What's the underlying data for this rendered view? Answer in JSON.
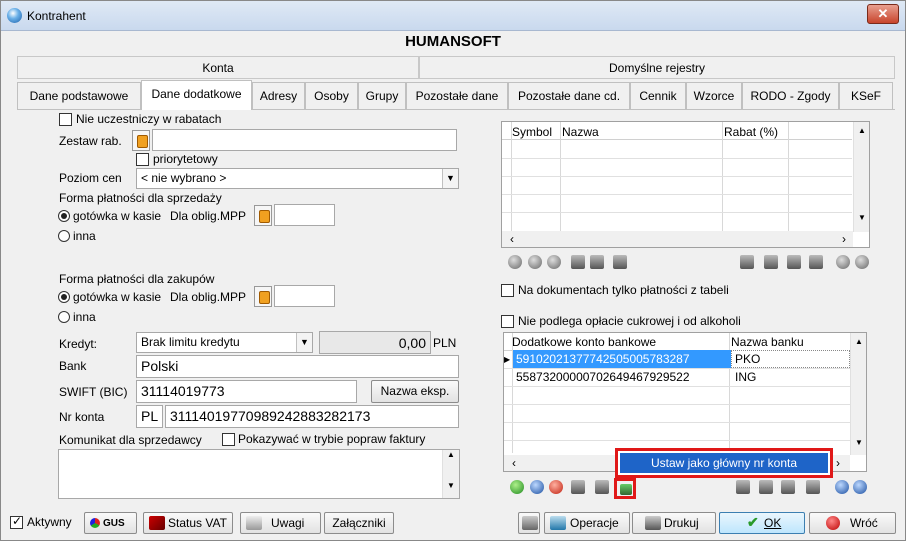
{
  "window": {
    "title": "Kontrahent",
    "close_glyph": "✕"
  },
  "header": {
    "title": "HUMANSOFT"
  },
  "group_tabs": [
    "Konta",
    "Domyślne rejestry"
  ],
  "tabs": [
    "Dane podstawowe",
    "Dane dodatkowe",
    "Adresy",
    "Osoby",
    "Grupy",
    "Pozostałe dane",
    "Pozostałe dane cd.",
    "Cennik",
    "Wzorce",
    "RODO - Zgody",
    "KSeF"
  ],
  "active_tab": "Dane dodatkowe",
  "left": {
    "nie_uczestniczy": "Nie uczestniczy w rabatach",
    "zestaw_rab_label": "Zestaw rab.",
    "zestaw_rab_value": "",
    "priorytetowy": "priorytetowy",
    "poziom_cen_label": "Poziom cen",
    "poziom_cen_value": "< nie wybrano >",
    "forma_sprzedazy_label": "Forma płatności dla sprzedaży",
    "gotowka_label": "gotówka w kasie",
    "dla_oblig_label": "Dla oblig.MPP",
    "inna_label": "inna",
    "forma_zakupow_label": "Forma płatności dla zakupów",
    "kredyt_label": "Kredyt:",
    "kredyt_value": "Brak limitu kredytu",
    "kredyt_amount": "0,00",
    "kredyt_currency": "PLN",
    "bank_label": "Bank",
    "bank_value": "Polski",
    "swift_label": "SWIFT (BIC)",
    "swift_value": "31114019773",
    "nazwa_eksp_button": "Nazwa eksp.",
    "nr_konta_label": "Nr konta",
    "nr_konta_prefix": "PL",
    "nr_konta_value": "31114019770989242883282173",
    "komunikat_label": "Komunikat dla sprzedawcy",
    "pokazywac_label": "Pokazywać w trybie popraw faktury",
    "komunikat_value": ""
  },
  "rabat_grid": {
    "columns": [
      "Symbol",
      "Nazwa",
      "Rabat (%)"
    ]
  },
  "na_dokumentach": "Na dokumentach tylko płatności z tabeli",
  "nie_podlega": "Nie podlega opłacie cukrowej i od alkoholi",
  "bank_grid": {
    "columns": [
      "Dodatkowe konto bankowe",
      "Nazwa banku"
    ],
    "rows": [
      {
        "konto": "59102021377742505005783287",
        "bank": "PKO"
      },
      {
        "konto": "55873200000702649467929522",
        "bank": "ING"
      }
    ]
  },
  "context_menu": {
    "item": "Ustaw jako główny nr konta"
  },
  "footer": {
    "aktywny": "Aktywny",
    "gus": "GUS",
    "status_vat": "Status VAT",
    "uwagi": "Uwagi",
    "zalaczniki": "Załączniki",
    "operacje": "Operacje",
    "drukuj": "Drukuj",
    "ok": "OK",
    "wroc": "Wróć"
  },
  "colors": {
    "selection": "#3399ff",
    "highlight_menu": "#1e64c8",
    "red_box": "#e01818"
  }
}
